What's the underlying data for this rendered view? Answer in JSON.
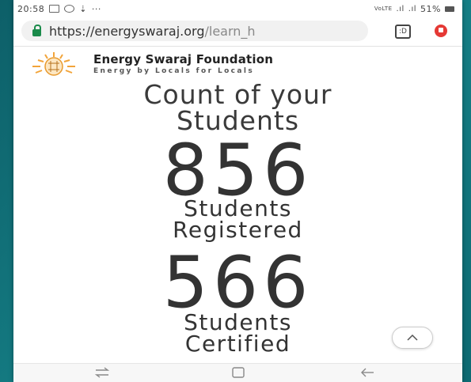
{
  "status_bar": {
    "time": "20:58",
    "notification_icons": [
      "gallery-icon",
      "whatsapp-icon",
      "download-icon"
    ],
    "more": "···",
    "battery": "51%",
    "network": "VoLTE"
  },
  "browser": {
    "url_host": "https://energyswaraj.org",
    "url_path": "/learn_h",
    "tab_count": ":D"
  },
  "site": {
    "title": "Energy Swaraj Foundation",
    "tagline": "Energy by Locals for Locals"
  },
  "counter": {
    "heading": "Count of your Students",
    "registered": {
      "value": "856",
      "label_line1": "Students",
      "label_line2": "Registered"
    },
    "certified": {
      "value": "566",
      "label_line1": "Students",
      "label_line2": "Certified"
    }
  },
  "colors": {
    "frame": "#0f6f76",
    "lock": "#1a8a4a",
    "menu": "#e53935",
    "text": "#333333"
  }
}
